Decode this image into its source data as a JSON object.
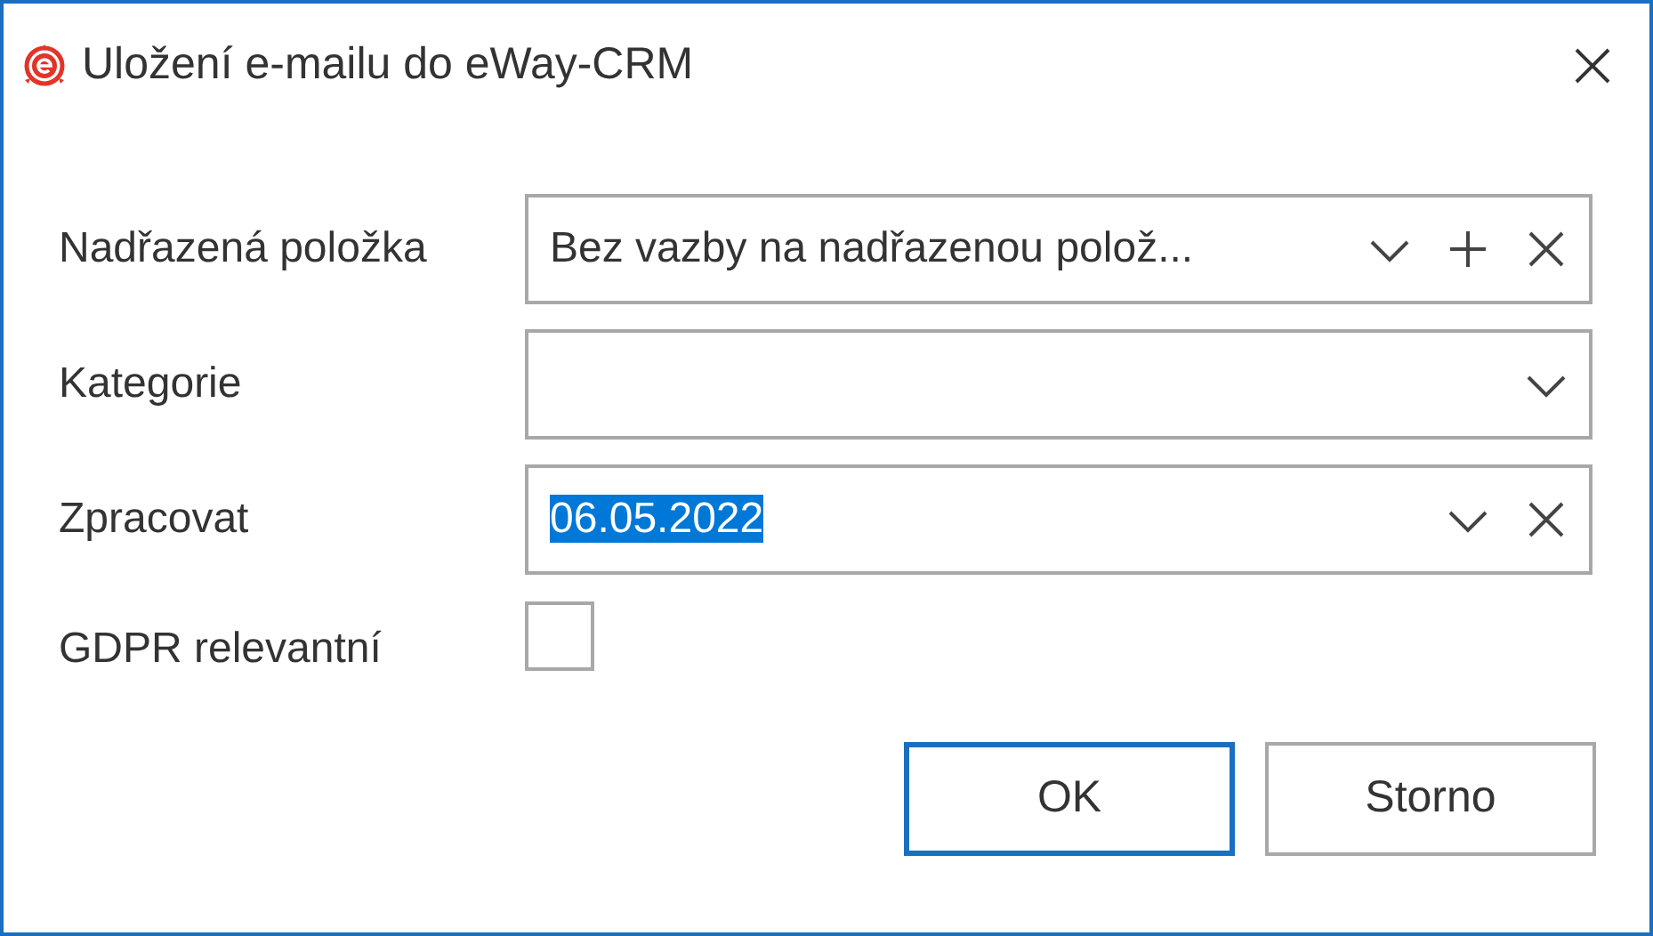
{
  "window": {
    "title": "Uložení e-mailu do eWay-CRM"
  },
  "fields": [
    {
      "kind": "combo",
      "label": "Nadřazená položka",
      "value": "Bez vazby na nadřazenou polož...",
      "value_selected": false,
      "actions": [
        {
          "kind": "dropdown"
        },
        {
          "kind": "add"
        },
        {
          "kind": "clear"
        }
      ]
    },
    {
      "kind": "combo",
      "label": "Kategorie",
      "actions": [
        {
          "kind": "dropdown"
        }
      ]
    },
    {
      "kind": "combo",
      "label": "Zpracovat",
      "value": "06.05.2022",
      "value_selected": true,
      "actions": [
        {
          "kind": "dropdown"
        },
        {
          "kind": "clear"
        }
      ]
    },
    {
      "kind": "checkbox",
      "label": "GDPR relevantní",
      "checked": false
    }
  ],
  "buttons": [
    {
      "label": "OK",
      "default": true
    },
    {
      "label": "Storno",
      "default": false
    }
  ]
}
